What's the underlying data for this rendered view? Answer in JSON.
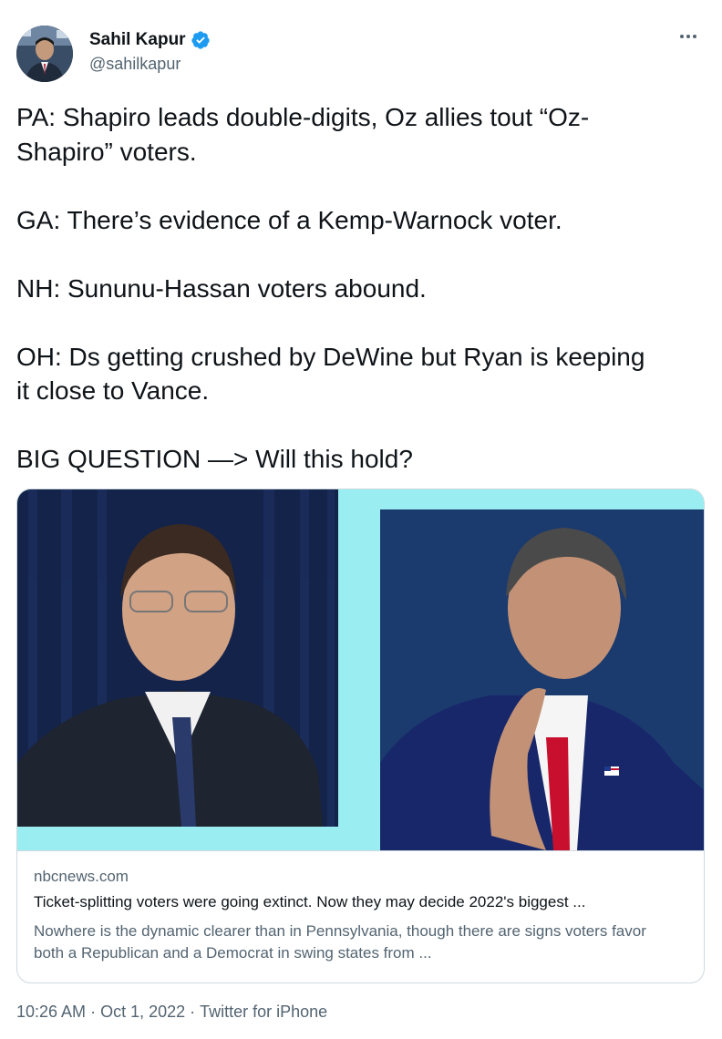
{
  "author": {
    "name": "Sahil Kapur",
    "handle": "@sahilkapur",
    "verified_color": "#1d9bf0"
  },
  "tweet": {
    "lines": [
      "PA: Shapiro leads double-digits, Oz allies tout “Oz-",
      "Shapiro” voters.",
      "GA: There’s evidence of a Kemp-Warnock voter.",
      "NH: Sununu-Hassan voters abound.",
      "OH: Ds getting crushed by DeWine but Ryan is keeping",
      "it close to Vance.",
      "BIG QUESTION —> Will this hold?"
    ]
  },
  "card": {
    "domain": "nbcnews.com",
    "title": "Ticket-splitting voters were going extinct. Now they may decide 2022's biggest ...",
    "description": "Nowhere is the dynamic clearer than in Pennsylvania, though there are signs voters favor both a Republican and a Democrat in swing states from ...",
    "image_bg": "#9aeef2"
  },
  "footer": {
    "time": "10:26 AM",
    "separator": " · ",
    "date": "Oct 1, 2022",
    "source": "Twitter for iPhone"
  },
  "icons": {
    "more": "more-options-icon",
    "verified": "verified-badge-icon"
  }
}
